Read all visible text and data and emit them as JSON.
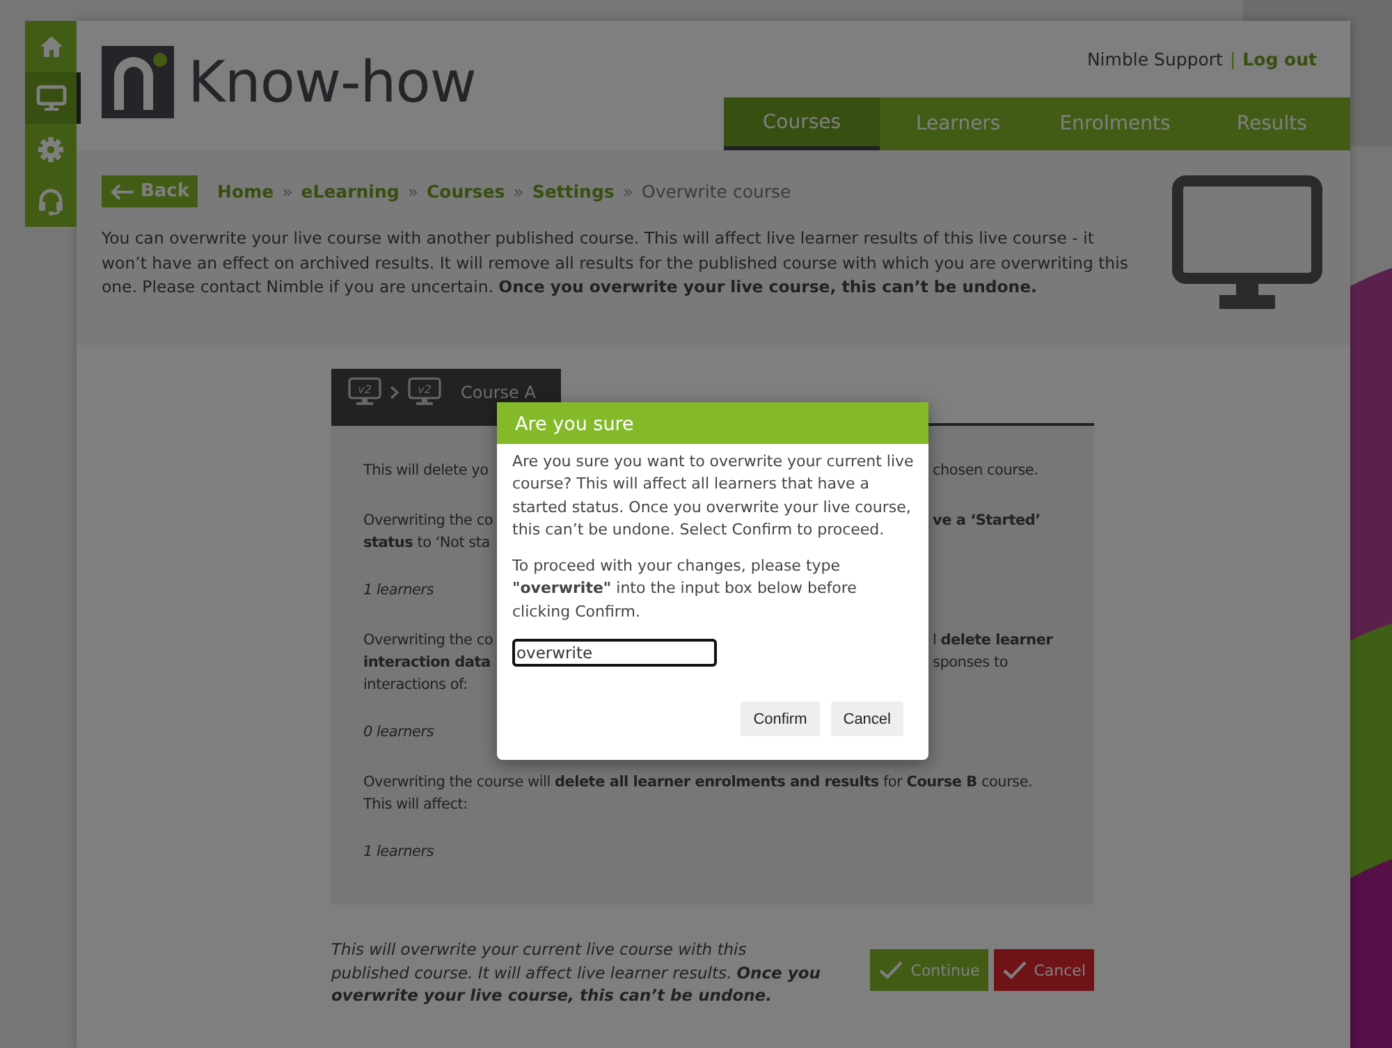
{
  "sidebar": {
    "items": [
      {
        "kind": "home",
        "selected": false
      },
      {
        "kind": "monitor",
        "selected": true
      },
      {
        "kind": "gear",
        "selected": false
      },
      {
        "kind": "headset",
        "selected": false
      }
    ]
  },
  "header": {
    "logo_text": "Know-how",
    "user": "Nimble Support",
    "separator": "|",
    "logout": "Log out"
  },
  "nav": {
    "tabs": [
      {
        "label": "Courses",
        "selected": true
      },
      {
        "label": "Learners",
        "selected": false
      },
      {
        "label": "Enrolments",
        "selected": false
      },
      {
        "label": "Results",
        "selected": false
      }
    ]
  },
  "back_button": {
    "label": "Back"
  },
  "breadcrumb": {
    "links": [
      "Home",
      "eLearning",
      "Courses",
      "Settings"
    ],
    "separators": [
      "»",
      "»",
      "»",
      "»"
    ],
    "current": "Overwrite course"
  },
  "intro": "You can overwrite your live course with another published course. This will affect live learner results of this live course - it won’t have an effect on archived results. It will remove all results for the published course with which you are overwriting this one. Please contact Nimble if you are uncertain. **Once you overwrite your live course, this can’t be undone.**",
  "panel": {
    "tab": {
      "from_badge": "v2",
      "to_badge": "v2",
      "label": "Course A"
    },
    "blocks": [
      {
        "kind": "text",
        "lines": [
          {
            "left": "This will delete yo",
            "right": "chosen course."
          }
        ]
      },
      {
        "kind": "text",
        "lines": [
          {
            "left": "Overwriting the co",
            "right": "ve a ‘Started’",
            "right_bold": true
          },
          {
            "left": "**status** to ‘Not sta"
          }
        ]
      },
      {
        "kind": "count",
        "lines": [
          {
            "left": "1 learners"
          }
        ]
      },
      {
        "kind": "text",
        "lines": [
          {
            "left": "Overwriting the co",
            "right": "l **delete learner**"
          },
          {
            "left": "interaction data",
            "left_bold": true,
            "right": "sponses to"
          },
          {
            "left": "interactions of:"
          }
        ]
      },
      {
        "kind": "count",
        "lines": [
          {
            "left": "0 learners"
          }
        ]
      },
      {
        "kind": "text",
        "lines": [
          {
            "left": "Overwriting the course will **delete all learner enrolments and results** for **Course B** course. This will affect:"
          }
        ]
      },
      {
        "kind": "count",
        "lines": [
          {
            "left": "1 learners"
          }
        ]
      }
    ]
  },
  "footer": {
    "note": "This will overwrite your current live course with this published course. It will affect live learner results. **Once you overwrite your live course, this can’t be undone.**",
    "buttons": [
      {
        "label": "Continue",
        "kind": "continue"
      },
      {
        "label": "Cancel",
        "kind": "cancel"
      }
    ]
  },
  "dialog": {
    "title": "Are you sure",
    "paragraphs": [
      "Are you sure you want to overwrite your current live course? This will affect all learners that have a started status. Once you overwrite your live course, this can’t be undone. Select Confirm to proceed.",
      "To proceed with your changes, please type **\"overwrite\"** into the input box below before clicking Confirm."
    ],
    "input": {
      "value": "overwrite"
    },
    "buttons": [
      {
        "label": "Confirm"
      },
      {
        "label": "Cancel"
      }
    ]
  }
}
